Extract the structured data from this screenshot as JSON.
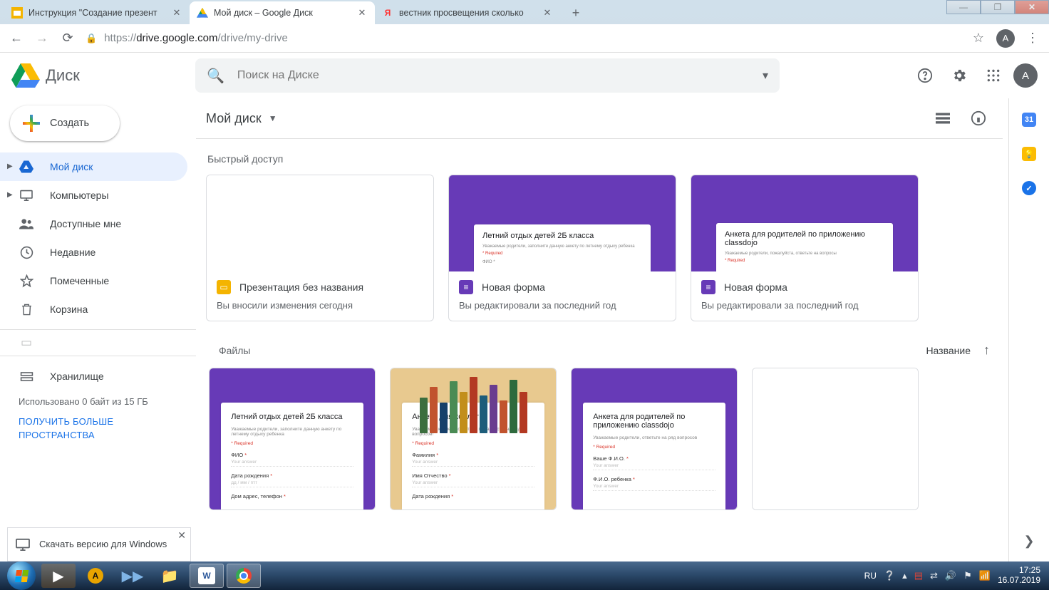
{
  "window": {
    "tabs": [
      {
        "title": "Инструкция \"Создание презент",
        "favicon": "slides"
      },
      {
        "title": "Мой диск – Google Диск",
        "favicon": "drive",
        "active": true
      },
      {
        "title": "вестник просвещения сколько",
        "favicon": "yandex"
      }
    ],
    "url_prefix": "https://",
    "url_host": "drive.google.com",
    "url_path": "/drive/my-drive",
    "avatar_letter": "A"
  },
  "drive": {
    "product": "Диск",
    "search_placeholder": "Поиск на Диске",
    "create_label": "Создать",
    "sidebar": [
      {
        "id": "mydrive",
        "label": "Мой диск",
        "caret": true,
        "active": true
      },
      {
        "id": "computers",
        "label": "Компьютеры",
        "caret": true
      },
      {
        "id": "shared",
        "label": "Доступные мне"
      },
      {
        "id": "recent",
        "label": "Недавние"
      },
      {
        "id": "starred",
        "label": "Помеченные"
      },
      {
        "id": "trash",
        "label": "Корзина"
      }
    ],
    "storage_title": "Хранилище",
    "storage_used": "Использовано 0 байт из 15 ГБ",
    "storage_link": "ПОЛУЧИТЬ БОЛЬШЕ ПРОСТРАНСТВА",
    "download_text": "Скачать версию для Windows",
    "path": "Мой диск",
    "quick_title": "Быстрый доступ",
    "quick": [
      {
        "icon": "slides",
        "title": "Презентация без названия",
        "sub": "Вы вносили изменения сегодня",
        "preview": "blank"
      },
      {
        "icon": "forms",
        "title": "Новая форма",
        "sub": "Вы редактировали за последний год",
        "preview": "form",
        "form_title": "Летний отдых детей 2Б класса"
      },
      {
        "icon": "forms",
        "title": "Новая форма",
        "sub": "Вы редактировали за последний год",
        "preview": "form",
        "form_title": "Анкета для родителей по приложению classdojo"
      }
    ],
    "files_label": "Файлы",
    "sort_label": "Название",
    "files": [
      {
        "bg": "purple",
        "form_title": "Летний отдых детей 2Б класса",
        "fields": [
          "ФИО",
          "Дата рождения",
          "Дом адрес, телефон"
        ]
      },
      {
        "bg": "books",
        "form_title": "Анкета для коллег",
        "fields": [
          "Фамилия",
          "Имя Отчество",
          "Дата рождения"
        ]
      },
      {
        "bg": "purple",
        "form_title": "Анкета для родителей по приложению classdojo",
        "fields": [
          "Ваше Ф.И.О.",
          "Ф.И.О. ребенка"
        ]
      },
      {
        "bg": "blank"
      }
    ]
  },
  "taskbar": {
    "lang": "RU",
    "time": "17:25",
    "date": "16.07.2019"
  }
}
